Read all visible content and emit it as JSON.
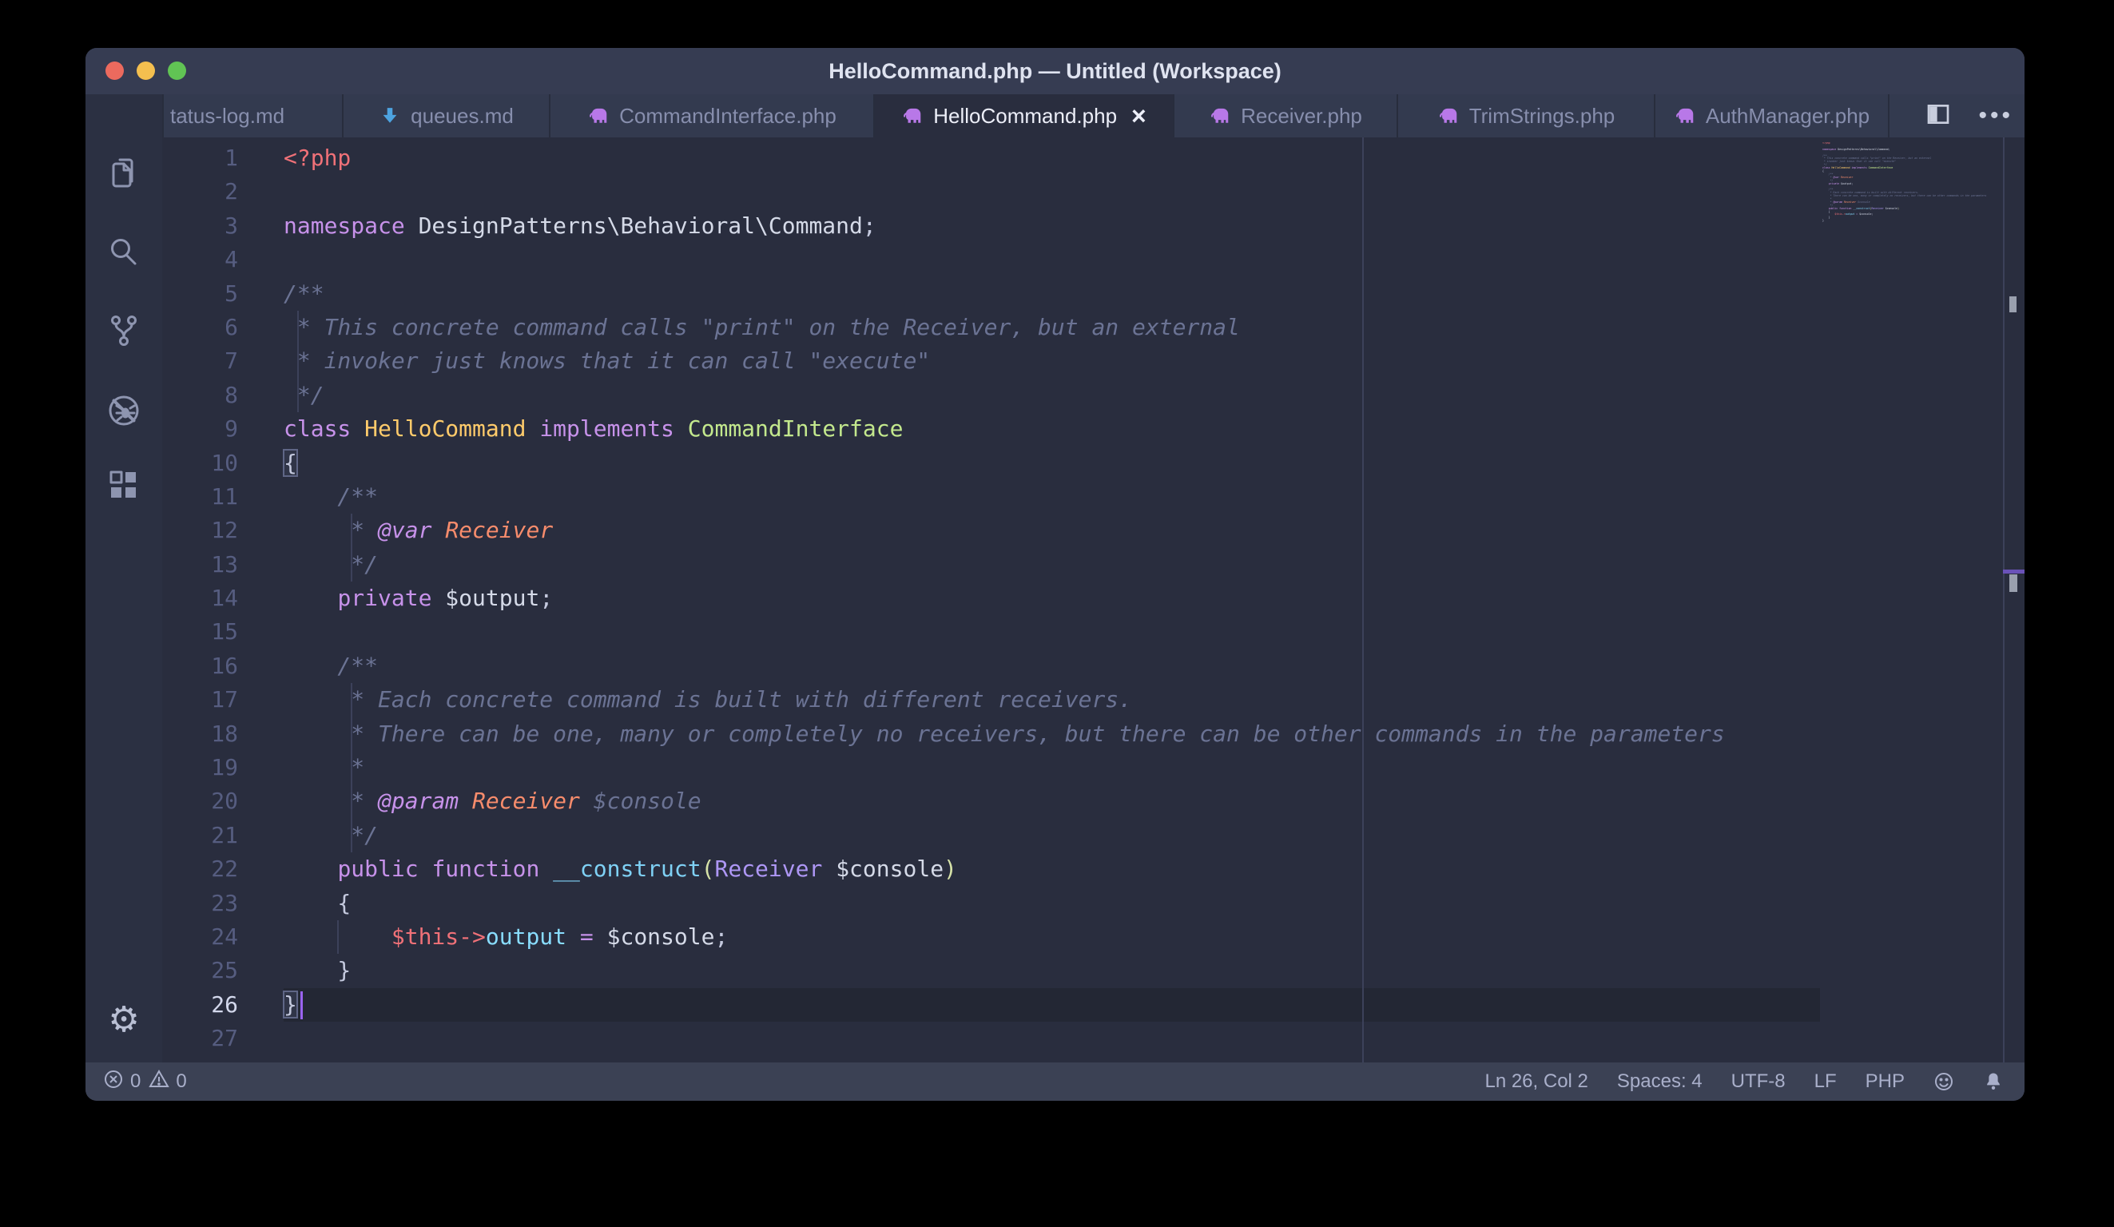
{
  "window": {
    "title": "HelloCommand.php — Untitled (Workspace)"
  },
  "traffic_lights": [
    {
      "name": "close",
      "color": "#ec6a5e"
    },
    {
      "name": "minimize",
      "color": "#f4bf4f"
    },
    {
      "name": "zoom",
      "color": "#61c454"
    }
  ],
  "activity_bar": {
    "items": [
      {
        "icon": "files"
      },
      {
        "icon": "search"
      },
      {
        "icon": "source-control"
      },
      {
        "icon": "debug-disabled"
      },
      {
        "icon": "extensions"
      }
    ],
    "settings_icon": "gear",
    "gear_glyph": "⚙"
  },
  "tabs": [
    {
      "label": "tatus-log.md",
      "icon": "none",
      "active": false
    },
    {
      "label": "queues.md",
      "icon": "arrow-down",
      "active": false
    },
    {
      "label": "CommandInterface.php",
      "icon": "php",
      "active": false
    },
    {
      "label": "HelloCommand.php",
      "icon": "php",
      "active": true,
      "close_glyph": "×"
    },
    {
      "label": "Receiver.php",
      "icon": "php",
      "active": false
    },
    {
      "label": "TrimStrings.php",
      "icon": "php",
      "active": false
    },
    {
      "label": "AuthManager.php",
      "icon": "php",
      "active": false
    }
  ],
  "tab_actions": {
    "split_editor": "split-editor-icon",
    "more": "•••"
  },
  "editor": {
    "ruler_column": 80,
    "cursor": {
      "line": 26,
      "after_chars": 1
    },
    "lines": [
      {
        "n": 1,
        "tokens": [
          [
            "<?php",
            "red"
          ]
        ]
      },
      {
        "n": 2,
        "tokens": []
      },
      {
        "n": 3,
        "tokens": [
          [
            "namespace ",
            "purple"
          ],
          [
            "DesignPatterns\\Behavioral\\Command",
            "bright"
          ],
          [
            ";",
            "fg"
          ]
        ]
      },
      {
        "n": 4,
        "tokens": []
      },
      {
        "n": 5,
        "tokens": [
          [
            "/**",
            "comment"
          ]
        ]
      },
      {
        "n": 6,
        "tokens": [
          [
            " * This concrete command calls \"print\" on the Receiver, but an external",
            "comment"
          ]
        ],
        "guides": [
          1
        ]
      },
      {
        "n": 7,
        "tokens": [
          [
            " * invoker just knows that it can call \"execute\"",
            "comment"
          ]
        ],
        "guides": [
          1
        ]
      },
      {
        "n": 8,
        "tokens": [
          [
            " */",
            "comment"
          ]
        ],
        "guides": [
          1
        ]
      },
      {
        "n": 9,
        "tokens": [
          [
            "class ",
            "purple"
          ],
          [
            "HelloCommand ",
            "yellow"
          ],
          [
            "implements ",
            "purple"
          ],
          [
            "CommandInterface",
            "green"
          ]
        ]
      },
      {
        "n": 10,
        "tokens": [
          [
            "{",
            "fg bracket"
          ]
        ]
      },
      {
        "n": 11,
        "tokens": [
          [
            "    /**",
            "comment"
          ]
        ]
      },
      {
        "n": 12,
        "tokens": [
          [
            "     * ",
            "comment"
          ],
          [
            "@var ",
            "purpleI"
          ],
          [
            "Receiver",
            "orangeI"
          ]
        ],
        "guides": [
          5
        ]
      },
      {
        "n": 13,
        "tokens": [
          [
            "     */",
            "comment"
          ]
        ],
        "guides": [
          5
        ]
      },
      {
        "n": 14,
        "tokens": [
          [
            "    ",
            "fg"
          ],
          [
            "private ",
            "purple"
          ],
          [
            "$output",
            "bright"
          ],
          [
            ";",
            "fg"
          ]
        ]
      },
      {
        "n": 15,
        "tokens": []
      },
      {
        "n": 16,
        "tokens": [
          [
            "    /**",
            "comment"
          ]
        ]
      },
      {
        "n": 17,
        "tokens": [
          [
            "     * Each concrete command is built with different receivers.",
            "comment"
          ]
        ],
        "guides": [
          5
        ]
      },
      {
        "n": 18,
        "tokens": [
          [
            "     * There can be one, many or completely no receivers, but there can be other commands in the parameters",
            "comment"
          ]
        ],
        "guides": [
          5
        ]
      },
      {
        "n": 19,
        "tokens": [
          [
            "     *",
            "comment"
          ]
        ],
        "guides": [
          5
        ]
      },
      {
        "n": 20,
        "tokens": [
          [
            "     * ",
            "comment"
          ],
          [
            "@param ",
            "purpleI"
          ],
          [
            "Receiver ",
            "orangeI"
          ],
          [
            "$console",
            "comment"
          ]
        ],
        "guides": [
          5
        ]
      },
      {
        "n": 21,
        "tokens": [
          [
            "     */",
            "comment"
          ]
        ],
        "guides": [
          5
        ]
      },
      {
        "n": 22,
        "tokens": [
          [
            "    ",
            "fg"
          ],
          [
            "public ",
            "purple"
          ],
          [
            "function ",
            "purple"
          ],
          [
            "__construct",
            "blue"
          ],
          [
            "(",
            "paren"
          ],
          [
            "Receiver ",
            "violet"
          ],
          [
            "$console",
            "bright"
          ],
          [
            ")",
            "paren"
          ]
        ]
      },
      {
        "n": 23,
        "tokens": [
          [
            "    {",
            "fg"
          ]
        ]
      },
      {
        "n": 24,
        "tokens": [
          [
            "        ",
            "fg"
          ],
          [
            "$this",
            "red"
          ],
          [
            "->",
            "red"
          ],
          [
            "output ",
            "cyan"
          ],
          [
            "=",
            "purple"
          ],
          [
            " ",
            "fg"
          ],
          [
            "$console",
            "bright"
          ],
          [
            ";",
            "fg"
          ]
        ],
        "guides": [
          4
        ]
      },
      {
        "n": 25,
        "tokens": [
          [
            "    }",
            "fg"
          ]
        ]
      },
      {
        "n": 26,
        "tokens": [
          [
            "}",
            "fg bracket"
          ]
        ],
        "current": true
      },
      {
        "n": 27,
        "tokens": []
      }
    ]
  },
  "status_bar": {
    "left": [
      {
        "icon": "error",
        "value": "0"
      },
      {
        "icon": "warning",
        "value": "0"
      }
    ],
    "right": [
      "Ln 26, Col 2",
      "Spaces: 4",
      "UTF-8",
      "LF",
      "PHP"
    ],
    "right_icons": [
      "smiley",
      "bell"
    ]
  },
  "colors": {
    "titlebar": "#363c52",
    "tabbar": "#333a4f",
    "tabSep": "#282d3d",
    "activity": "#2b3042",
    "editorBg": "#292d3e",
    "statusbar": "#3b4154",
    "currentLine": "#232734",
    "gutter": "#565d80",
    "gutterActive": "#d3d8ec",
    "guide": "#3c415a",
    "tabText": "#878ead",
    "tabTextActive": "#eceef8",
    "icon": "#8e95b0",
    "elephant": "#b878e8",
    "arrowBlue": "#4da3e0",
    "statusText": "#a9afca",
    "titleText": "#dfe3f0",
    "tokRed": "#f07178",
    "tokPurple": "#c792ea",
    "tokViolet": "#ae97f5",
    "tokOrange": "#f78c6c",
    "tokComment": "#6b7394",
    "tokYellow": "#ffcb6b",
    "tokGreen": "#c3e88d",
    "tokBlue": "#7fd1f5",
    "tokCyan": "#89ddff",
    "tokFg": "#c4c9de",
    "tokBright": "#d5dae8",
    "tokParen": "#d6e2a8",
    "cursor": "#9a63f0",
    "bracketBorder": "#5f6686",
    "bracketBg": "#303548",
    "markerGray": "#9aa0ae",
    "markerPurple": "#6a52b8"
  }
}
